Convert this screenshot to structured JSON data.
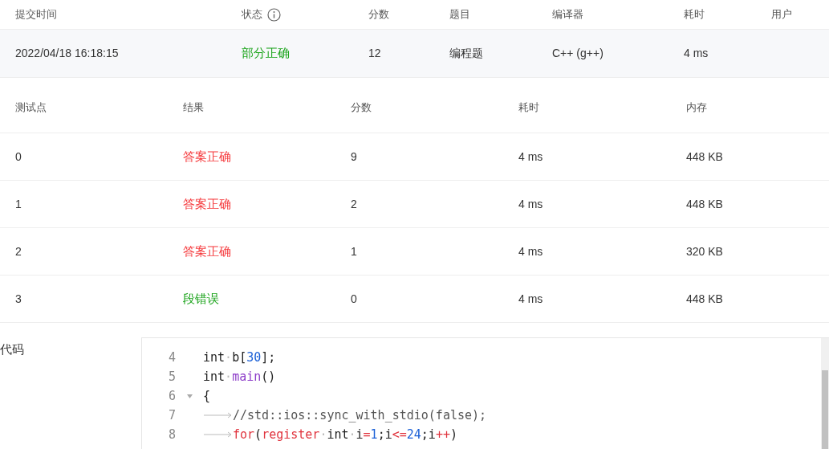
{
  "submission": {
    "columns": [
      {
        "label": "提交时间",
        "info": false
      },
      {
        "label": "状态",
        "info": true
      },
      {
        "label": "分数",
        "info": false
      },
      {
        "label": "题目",
        "info": false
      },
      {
        "label": "编译器",
        "info": false
      },
      {
        "label": "耗时",
        "info": false
      },
      {
        "label": "用户",
        "info": false
      }
    ],
    "row": {
      "time": "2022/04/18 16:18:15",
      "status": {
        "text": "部分正确",
        "kind": "partial"
      },
      "score": "12",
      "problem": "编程题",
      "compiler": "C++ (g++)",
      "duration": "4 ms"
    }
  },
  "tests": {
    "columns": [
      "测试点",
      "结果",
      "分数",
      "耗时",
      "内存"
    ],
    "rows": [
      {
        "id": "0",
        "result": "答案正确",
        "color": "#f5383b",
        "score": "9",
        "duration": "4 ms",
        "memory": "448 KB"
      },
      {
        "id": "1",
        "result": "答案正确",
        "color": "#f5383b",
        "score": "2",
        "duration": "4 ms",
        "memory": "448 KB"
      },
      {
        "id": "2",
        "result": "答案正确",
        "color": "#f5383b",
        "score": "1",
        "duration": "4 ms",
        "memory": "320 KB"
      },
      {
        "id": "3",
        "result": "段错误",
        "color": "#1aa31a",
        "score": "0",
        "duration": "4 ms",
        "memory": "448 KB"
      }
    ]
  },
  "code": {
    "label": "代码",
    "lines": [
      {
        "number": "4",
        "foldable": false,
        "tokens": [
          {
            "kind": "plain",
            "text": "int"
          },
          {
            "kind": "space",
            "text": "·"
          },
          {
            "kind": "plain",
            "text": "b["
          },
          {
            "kind": "number",
            "text": "30"
          },
          {
            "kind": "plain",
            "text": "];"
          }
        ]
      },
      {
        "number": "5",
        "foldable": false,
        "tokens": [
          {
            "kind": "plain",
            "text": "int"
          },
          {
            "kind": "space",
            "text": "·"
          },
          {
            "kind": "function",
            "text": "main"
          },
          {
            "kind": "plain",
            "text": "()"
          }
        ]
      },
      {
        "number": "6",
        "foldable": true,
        "tokens": [
          {
            "kind": "plain",
            "text": "{"
          }
        ]
      },
      {
        "number": "7",
        "foldable": false,
        "tokens": [
          {
            "kind": "tab"
          },
          {
            "kind": "comment",
            "text": "//std::ios::sync_with_stdio(false);"
          }
        ]
      },
      {
        "number": "8",
        "foldable": false,
        "tokens": [
          {
            "kind": "tab"
          },
          {
            "kind": "keyword",
            "text": "for"
          },
          {
            "kind": "plain",
            "text": "("
          },
          {
            "kind": "keyword",
            "text": "register"
          },
          {
            "kind": "space",
            "text": "·"
          },
          {
            "kind": "plain",
            "text": "int"
          },
          {
            "kind": "space",
            "text": "·"
          },
          {
            "kind": "plain",
            "text": "i"
          },
          {
            "kind": "keyword",
            "text": "="
          },
          {
            "kind": "number",
            "text": "1"
          },
          {
            "kind": "plain",
            "text": ";i"
          },
          {
            "kind": "keyword",
            "text": "<="
          },
          {
            "kind": "number",
            "text": "24"
          },
          {
            "kind": "plain",
            "text": ";i"
          },
          {
            "kind": "keyword",
            "text": "++"
          },
          {
            "kind": "plain",
            "text": ")"
          }
        ]
      }
    ]
  }
}
